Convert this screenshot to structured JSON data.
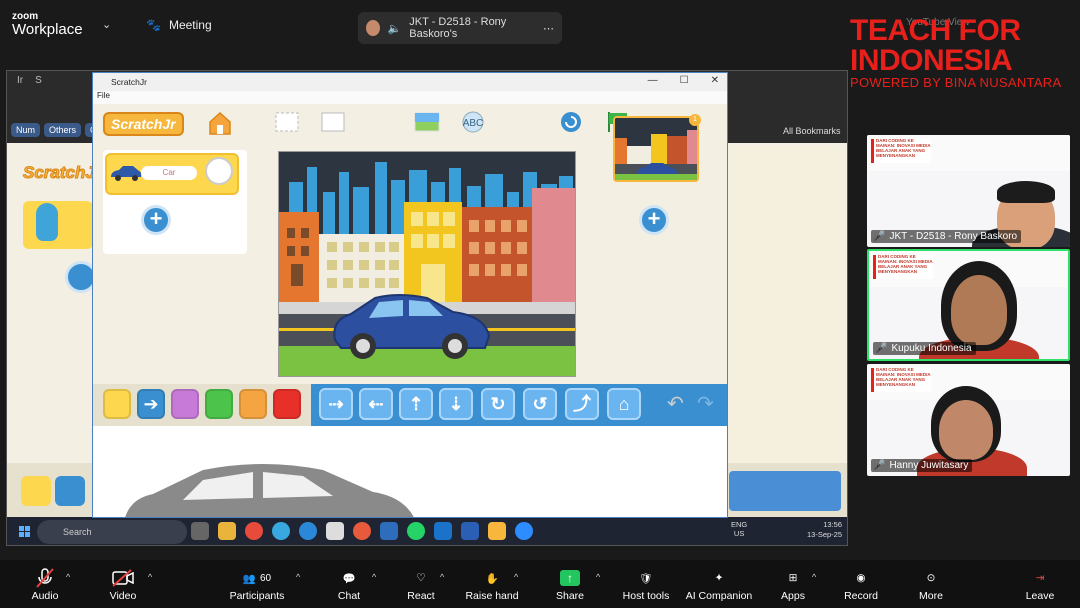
{
  "zoom": {
    "logo_small": "zoom",
    "logo_big": "Workplace",
    "meeting_label": "Meeting",
    "speaker": "JKT - D2518 - Rony Baskoro's",
    "top_dim": "YouTube    View"
  },
  "branding": {
    "line1": "TEACH FOR",
    "line2": "INDONESIA",
    "line3": "POWERED BY BINA NUSANTARA"
  },
  "browser": {
    "tabs": [
      "Ir",
      "S"
    ],
    "bookmarks": [
      "Num",
      "Others",
      "Gm"
    ],
    "all_bookmarks": "All Bookmarks"
  },
  "scratch": {
    "window_title": "ScratchJr",
    "menu_file": "File",
    "logo": "ScratchJr",
    "sprite_name": "Car",
    "page_number": "1",
    "add_symbol": "+"
  },
  "taskbar": {
    "search": "Search",
    "lang_top": "ENG",
    "lang_bottom": "US",
    "time": "13:56",
    "date": "13-Sep-25"
  },
  "participants": [
    {
      "name": "JKT - D2518 - Rony Baskoro"
    },
    {
      "name": "Kupuku Indonesia"
    },
    {
      "name": "Hanny Juwitasary"
    }
  ],
  "slide_text": "DARI CODING KE MAINAN: INOVASI MEDIA BELAJAR ANAK YANG MENYENANGKAN",
  "toolbar": {
    "audio": "Audio",
    "video": "Video",
    "participants": "Participants",
    "participants_count": "60",
    "chat": "Chat",
    "react": "React",
    "raise_hand": "Raise hand",
    "share": "Share",
    "host_tools": "Host tools",
    "ai_companion": "AI Companion",
    "apps": "Apps",
    "record": "Record",
    "more": "More",
    "leave": "Leave"
  }
}
